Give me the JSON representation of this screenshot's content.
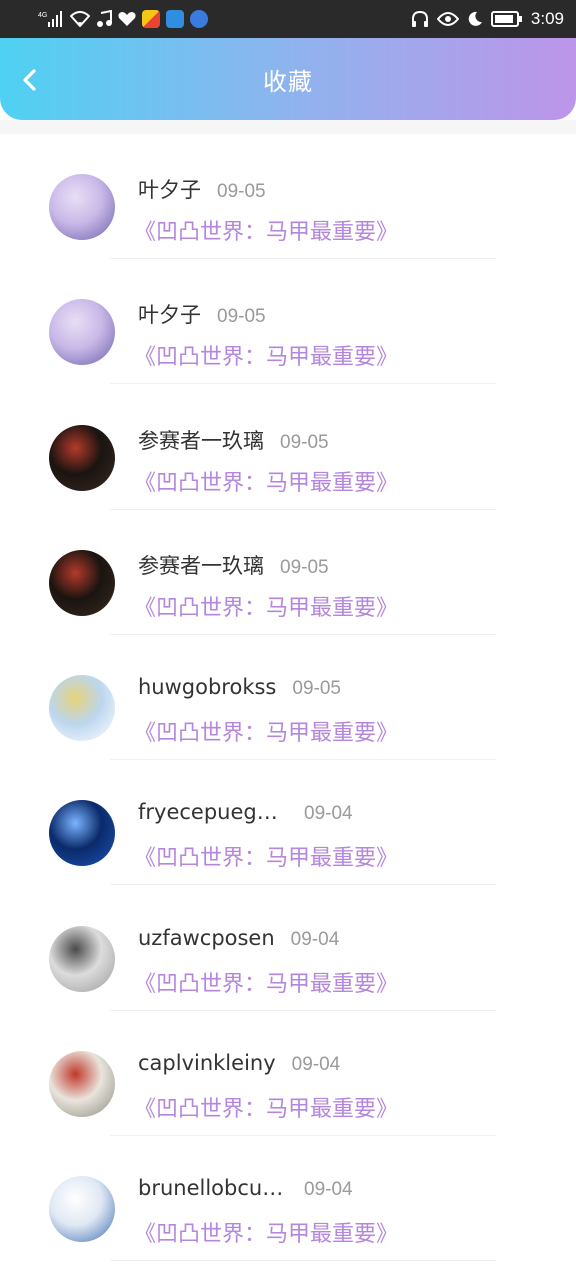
{
  "status_bar": {
    "network": "4G",
    "time": "3:09"
  },
  "header": {
    "title": "收藏",
    "back_icon": "chevron-left-icon"
  },
  "items": [
    {
      "name": "叶夕子",
      "date": "09-05",
      "title": "《凹凸世界：马甲最重要》",
      "avatar_colors": [
        "#c9b8e8",
        "#6a5fa8",
        "#e8dff5"
      ]
    },
    {
      "name": "叶夕子",
      "date": "09-05",
      "title": "《凹凸世界：马甲最重要》",
      "avatar_colors": [
        "#c9b8e8",
        "#6a5fa8",
        "#e8dff5"
      ]
    },
    {
      "name": "参赛者一玖璃",
      "date": "09-05",
      "title": "《凹凸世界：马甲最重要》",
      "avatar_colors": [
        "#1a1410",
        "#3a2a22",
        "#b53a2a"
      ]
    },
    {
      "name": "参赛者一玖璃",
      "date": "09-05",
      "title": "《凹凸世界：马甲最重要》",
      "avatar_colors": [
        "#1a1410",
        "#3a2a22",
        "#b53a2a"
      ]
    },
    {
      "name": "huwgobrokss",
      "date": "09-05",
      "title": "《凹凸世界：马甲最重要》",
      "avatar_colors": [
        "#bcd6ee",
        "#ffffff",
        "#e6d27a"
      ]
    },
    {
      "name": "fryecepuego...",
      "date": "09-04",
      "title": "《凹凸世界：马甲最重要》",
      "avatar_colors": [
        "#0a2a6a",
        "#1e56b8",
        "#7bb4ff"
      ]
    },
    {
      "name": "uzfawcposen",
      "date": "09-04",
      "title": "《凹凸世界：马甲最重要》",
      "avatar_colors": [
        "#dcdcdc",
        "#9a9a9a",
        "#4a4a4a"
      ]
    },
    {
      "name": "caplvinkleiny",
      "date": "09-04",
      "title": "《凹凸世界：马甲最重要》",
      "avatar_colors": [
        "#e9e4dc",
        "#8a8a80",
        "#c0392b"
      ]
    },
    {
      "name": "brunellobcuc...",
      "date": "09-04",
      "title": "《凹凸世界：马甲最重要》",
      "avatar_colors": [
        "#dfe8f4",
        "#3a6bb0",
        "#ffffff"
      ]
    }
  ]
}
